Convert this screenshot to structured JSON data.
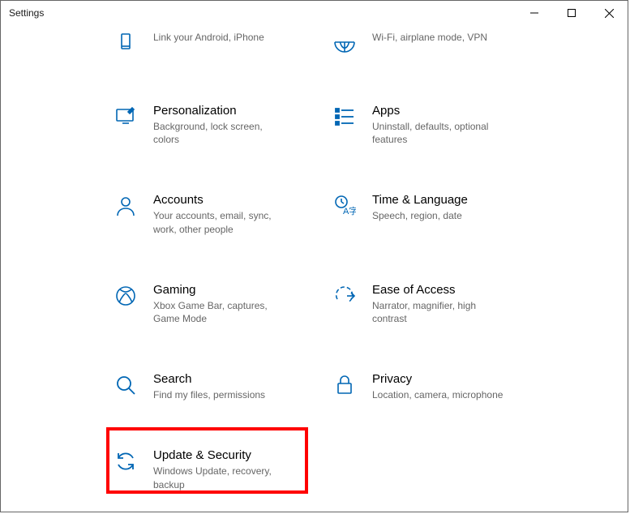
{
  "window": {
    "title": "Settings"
  },
  "tiles": {
    "phone": {
      "title": "",
      "desc": "Link your Android, iPhone"
    },
    "network": {
      "title": "",
      "desc": "Wi-Fi, airplane mode, VPN"
    },
    "personalization": {
      "title": "Personalization",
      "desc": "Background, lock screen, colors"
    },
    "apps": {
      "title": "Apps",
      "desc": "Uninstall, defaults, optional features"
    },
    "accounts": {
      "title": "Accounts",
      "desc": "Your accounts, email, sync, work, other people"
    },
    "time": {
      "title": "Time & Language",
      "desc": "Speech, region, date"
    },
    "gaming": {
      "title": "Gaming",
      "desc": "Xbox Game Bar, captures, Game Mode"
    },
    "ease": {
      "title": "Ease of Access",
      "desc": "Narrator, magnifier, high contrast"
    },
    "search": {
      "title": "Search",
      "desc": "Find my files, permissions"
    },
    "privacy": {
      "title": "Privacy",
      "desc": "Location, camera, microphone"
    },
    "update": {
      "title": "Update & Security",
      "desc": "Windows Update, recovery, backup"
    }
  }
}
